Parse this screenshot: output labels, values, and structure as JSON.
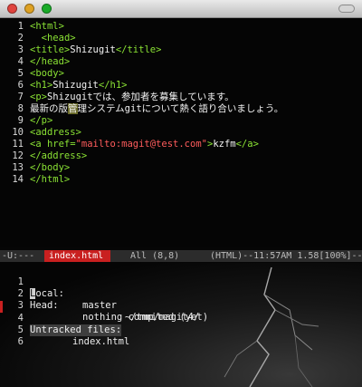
{
  "editor": {
    "lines": [
      {
        "n": "1",
        "parts": [
          {
            "t": "tag",
            "v": "<html>"
          }
        ]
      },
      {
        "n": "2",
        "parts": [
          {
            "t": "plain",
            "v": "  "
          },
          {
            "t": "tag",
            "v": "<head>"
          }
        ]
      },
      {
        "n": "3",
        "parts": [
          {
            "t": "tag",
            "v": "<title>"
          },
          {
            "t": "plain",
            "v": "Shizugit"
          },
          {
            "t": "tag",
            "v": "</title>"
          }
        ]
      },
      {
        "n": "4",
        "parts": [
          {
            "t": "tag",
            "v": "</head>"
          }
        ]
      },
      {
        "n": "5",
        "parts": [
          {
            "t": "tag",
            "v": "<body>"
          }
        ]
      },
      {
        "n": "6",
        "parts": [
          {
            "t": "tag",
            "v": "<h1>"
          },
          {
            "t": "plain",
            "v": "Shizugit"
          },
          {
            "t": "tag",
            "v": "</h1>"
          }
        ]
      },
      {
        "n": "7",
        "parts": [
          {
            "t": "tag",
            "v": "<p>"
          },
          {
            "t": "plain",
            "v": "Shizugitでは、参加者を募集しています。"
          }
        ]
      },
      {
        "n": "8",
        "parts": [
          {
            "t": "plain",
            "v": "最新の版"
          },
          {
            "t": "hl",
            "v": "管"
          },
          {
            "t": "plain",
            "v": "理システムgitについて熱く語り合いましょう。"
          }
        ]
      },
      {
        "n": "9",
        "parts": [
          {
            "t": "tag",
            "v": "</p>"
          }
        ]
      },
      {
        "n": "10",
        "parts": [
          {
            "t": "tag",
            "v": "<address>"
          }
        ]
      },
      {
        "n": "11",
        "parts": [
          {
            "t": "tag",
            "v": "<a href="
          },
          {
            "t": "str",
            "v": "\"mailto:magit@test.com\""
          },
          {
            "t": "tag",
            "v": ">"
          },
          {
            "t": "plain",
            "v": "kzfm"
          },
          {
            "t": "tag",
            "v": "</a>"
          }
        ]
      },
      {
        "n": "12",
        "parts": [
          {
            "t": "tag",
            "v": "</address>"
          }
        ]
      },
      {
        "n": "13",
        "parts": [
          {
            "t": "tag",
            "v": "</body>"
          }
        ]
      },
      {
        "n": "14",
        "parts": [
          {
            "t": "tag",
            "v": "</html>"
          }
        ]
      }
    ]
  },
  "modeline": {
    "state": "-U:---",
    "buffer": "index.html",
    "position": "All (8,8)",
    "mode_info": "(HTML)--11:57AM 1.58[100%]--"
  },
  "magit": {
    "local_first_char": "L",
    "local_rest": "ocal:",
    "local_branch": "master",
    "local_path": "~/tmp/magit4/",
    "head_label": "Head:",
    "head_value": "nothing commited (yet)",
    "untracked_header": "Untracked files:",
    "untracked_files": [
      "index.html"
    ],
    "line_numbers": [
      "1",
      "2",
      "3",
      "4",
      "5",
      "6"
    ]
  },
  "colors": {
    "tag": "#8ae234",
    "string": "#ff5c5c",
    "modeline_buffer_bg": "#c92020"
  }
}
